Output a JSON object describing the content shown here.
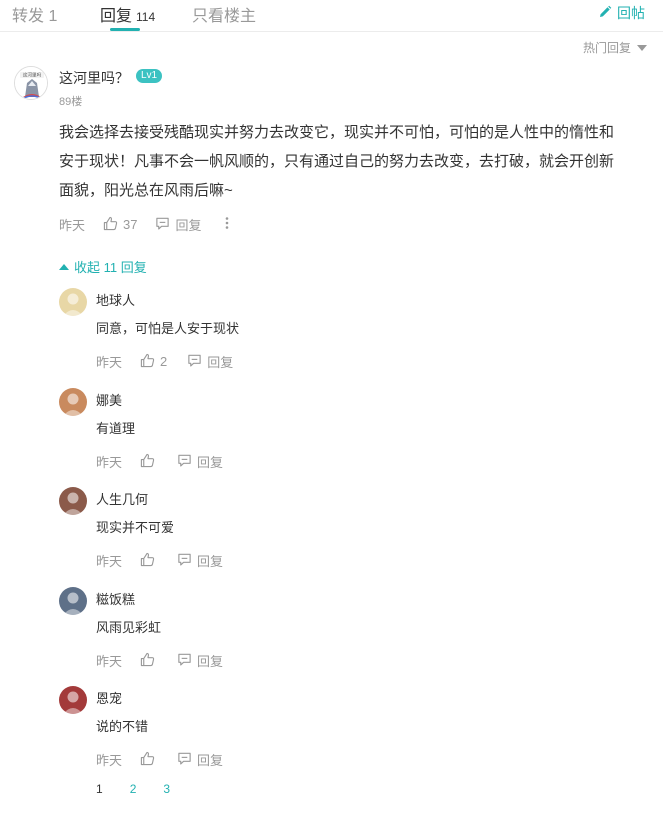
{
  "tabs": [
    {
      "label": "转发",
      "count": "1"
    },
    {
      "label": "回复",
      "count": "114"
    },
    {
      "label": "只看楼主",
      "count": ""
    }
  ],
  "reply_post_label": "回帖",
  "sort_label": "热门回复",
  "main_comment": {
    "avatar_text": "这河里吗",
    "username": "这河里吗？",
    "level": "Lv1",
    "floor": "89楼",
    "content_lines": [
      "我会选择去接受残酷现实并努力去改变它，现实并不可怕，可怕的是人性中的惰性和",
      "安于现状！凡事不会一帆风顺的，只有通过自己的努力去改变，去打破，就会开创新",
      "面貌，阳光总在风雨后嘛~"
    ],
    "time": "昨天",
    "likes": "37",
    "reply_label": "回复"
  },
  "collapse_label": "收起 11 回复",
  "replies": [
    {
      "name": "地球人",
      "text": "同意，可怕是人安于现状",
      "time": "昨天",
      "likes": "2",
      "reply_label": "回复",
      "avatar_color": "#e8d7a6"
    },
    {
      "name": "娜美",
      "text": "有道理",
      "time": "昨天",
      "likes": "",
      "reply_label": "回复",
      "avatar_color": "#c98a5e"
    },
    {
      "name": "人生几何",
      "text": "现实并不可爱",
      "time": "昨天",
      "likes": "",
      "reply_label": "回复",
      "avatar_color": "#8b5a4a"
    },
    {
      "name": "糍饭糕",
      "text": "风雨见彩虹",
      "time": "昨天",
      "likes": "",
      "reply_label": "回复",
      "avatar_color": "#5e7088"
    },
    {
      "name": "恩宠",
      "text": "说的不错",
      "time": "昨天",
      "likes": "",
      "reply_label": "回复",
      "avatar_color": "#a33a3a"
    }
  ],
  "pagination": [
    "1",
    "2",
    "3"
  ],
  "colors": {
    "accent": "#22b1b1",
    "text": "#333333",
    "muted": "#999999"
  }
}
